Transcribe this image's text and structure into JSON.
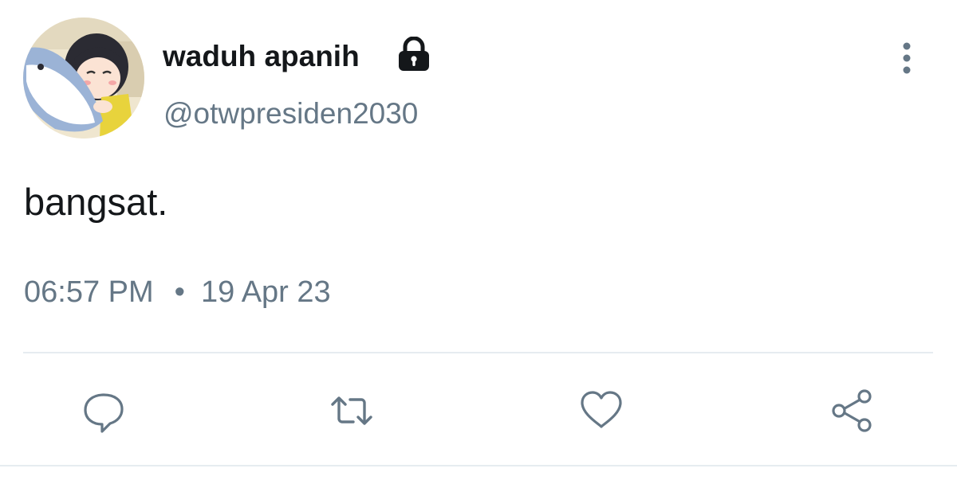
{
  "tweet": {
    "display_name": "waduh apanih",
    "handle": "@otwpresiden2030",
    "text": "bangsat.",
    "time": "06:57 PM",
    "separator": "•",
    "date": "19 Apr 23",
    "protected_icon": "lock-icon"
  },
  "actions": [
    {
      "name": "reply",
      "icon": "reply-icon"
    },
    {
      "name": "retweet",
      "icon": "retweet-icon"
    },
    {
      "name": "like",
      "icon": "heart-icon"
    },
    {
      "name": "share",
      "icon": "share-icon"
    }
  ],
  "colors": {
    "text_primary": "#14171a",
    "text_secondary": "#657786",
    "icon": "#657786",
    "divider": "#e6ecf0"
  }
}
